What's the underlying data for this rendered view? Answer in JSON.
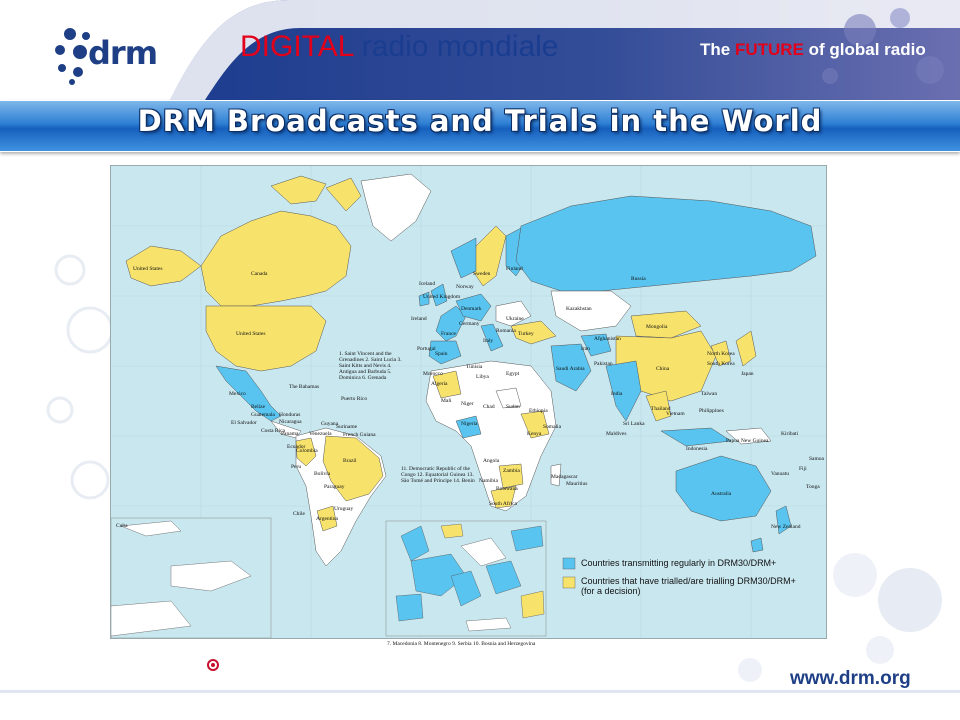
{
  "header": {
    "logo_text": "drm",
    "brand_part1": "DIGITAL",
    "brand_part2": "radio mondiale",
    "tagline_pre": "The ",
    "tagline_highlight": "FUTURE",
    "tagline_post": " of global radio"
  },
  "title": "DRM Broadcasts and Trials in the World",
  "colors": {
    "transmitting": "#58c4ef",
    "trialling": "#f7e26b",
    "other": "#ffffff",
    "ocean": "#c9e7ef"
  },
  "legend": [
    {
      "label": "Countries transmitting regularly in DRM30/DRM+",
      "color": "#58c4ef"
    },
    {
      "label": "Countries that have trialled/are trialling DRM30/DRM+ (for a decision)",
      "color": "#f7e26b"
    }
  ],
  "map_labels": {
    "united_states_top": "United States",
    "canada": "Canada",
    "united_states": "United States",
    "mexico": "Mexico",
    "bahamas": "The Bahamas",
    "cuba": "Cuba",
    "puerto_rico": "Puerto Rico",
    "belize": "Belize",
    "guatemala": "Guatemala",
    "honduras": "Honduras",
    "el_salvador": "El Salvador",
    "nicaragua": "Nicaragua",
    "costa_rica": "Costa Rica",
    "panama": "Panama",
    "colombia": "Colombia",
    "venezuela": "Venezuela",
    "guyana": "Guyana",
    "suriname": "Suriname",
    "french_guiana": "French Guiana",
    "ecuador": "Ecuador",
    "peru": "Peru",
    "brazil": "Brazil",
    "bolivia": "Bolivia",
    "paraguay": "Paraguay",
    "chile": "Chile",
    "argentina": "Argentina",
    "uruguay": "Uruguay",
    "iceland": "Iceland",
    "ireland": "Ireland",
    "united_kingdom": "United Kingdom",
    "norway": "Norway",
    "sweden": "Sweden",
    "finland": "Finland",
    "denmark": "Denmark",
    "estonia": "Estonia",
    "latvia": "Latvia",
    "lithuania": "Lithuania",
    "belarus": "Belarus",
    "poland": "Poland",
    "germany": "Germany",
    "france": "France",
    "spain": "Spain",
    "portugal": "Portugal",
    "italy": "Italy",
    "ukraine": "Ukraine",
    "romania": "Romania",
    "bulgaria": "Bulgaria",
    "turkey": "Turkey",
    "greece": "Greece",
    "cyprus": "Cyprus",
    "russia": "Russia",
    "kazakhstan": "Kazakhstan",
    "mongolia": "Mongolia",
    "china": "China",
    "north_korea": "North Korea",
    "south_korea": "South Korea",
    "japan": "Japan",
    "taiwan": "Taiwan",
    "philippines": "Philippines",
    "vietnam": "Vietnam",
    "thailand": "Thailand",
    "india": "India",
    "pakistan": "Pakistan",
    "iran": "Iran",
    "afghanistan": "Afghanistan",
    "saudi_arabia": "Saudi Arabia",
    "egypt": "Egypt",
    "libya": "Libya",
    "algeria": "Algeria",
    "morocco": "Morocco",
    "tunisia": "Tunisia",
    "mali": "Mali",
    "niger": "Niger",
    "chad": "Chad",
    "sudan": "Sudan",
    "ethiopia": "Ethiopia",
    "somalia": "Somalia",
    "kenya": "Kenya",
    "nigeria": "Nigeria",
    "angola": "Angola",
    "zambia": "Zambia",
    "namibia": "Namibia",
    "botswana": "Botswana",
    "south_africa": "South Africa",
    "madagascar": "Madagascar",
    "mauritius": "Mauritius",
    "australia": "Australia",
    "new_zealand": "New Zealand",
    "indonesia": "Indonesia",
    "papua_new_guinea": "Papua New Guinea",
    "sri_lanka": "Sri Lanka",
    "maldives": "Maldives",
    "kiribati": "Kiribati",
    "fiji": "Fiji",
    "samoa": "Samoa",
    "tonga": "Tonga",
    "vanuatu": "Vanuatu"
  },
  "map_notes": {
    "caribbean_list": "1. Saint Vincent and the Grenadines  2. Saint Lucia  3. Saint Kitts and Nevis  4. Antigua and Barbuda  5. Dominica  6. Grenada",
    "africa_list": "11. Democratic Republic of the Congo  12. Equatorial Guinea  13. São Tomé and Príncipe  14. Benin",
    "europe_list": "7. Macedonia    8. Montenegro    9. Serbia    10. Bosnia and Herzegovina"
  },
  "footer": {
    "url": "www.drm.org"
  }
}
